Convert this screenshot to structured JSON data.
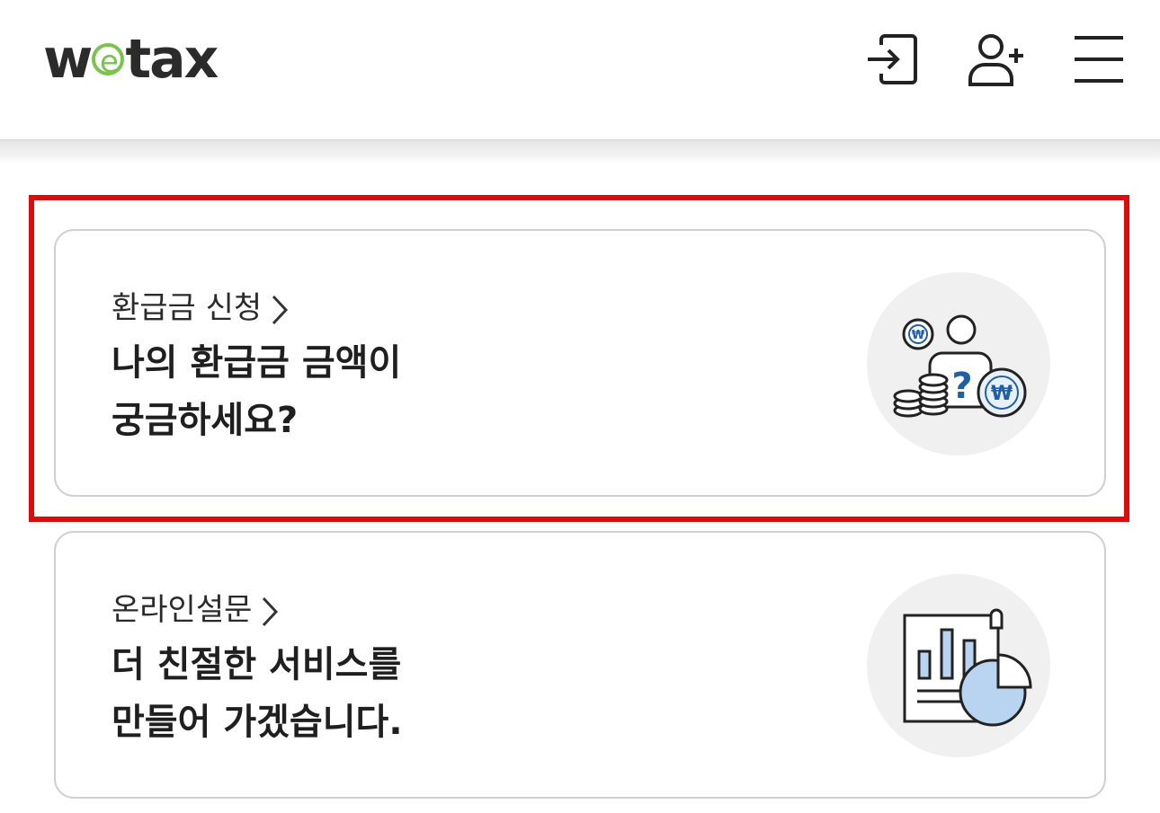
{
  "header": {
    "logo": {
      "prefix": "w",
      "mid": "e",
      "suffix": "tax"
    },
    "icons": [
      "login-icon",
      "signup-icon",
      "menu-icon"
    ]
  },
  "cards": [
    {
      "link": "환급금 신청",
      "title_lines": [
        "나의 환급금 금액이",
        "궁금하세요?"
      ],
      "icon": "refund-illustration",
      "highlighted": true
    },
    {
      "link": "온라인설문",
      "title_lines": [
        "더 친절한 서비스를",
        "만들어 가겠습니다."
      ],
      "icon": "survey-chart-illustration",
      "highlighted": false
    }
  ],
  "colors": {
    "highlight": "#dd0b0b",
    "logo_green": "#7cc24f",
    "accent_blue": "#1f5fa3",
    "chart_fill": "#b9d4f0"
  }
}
